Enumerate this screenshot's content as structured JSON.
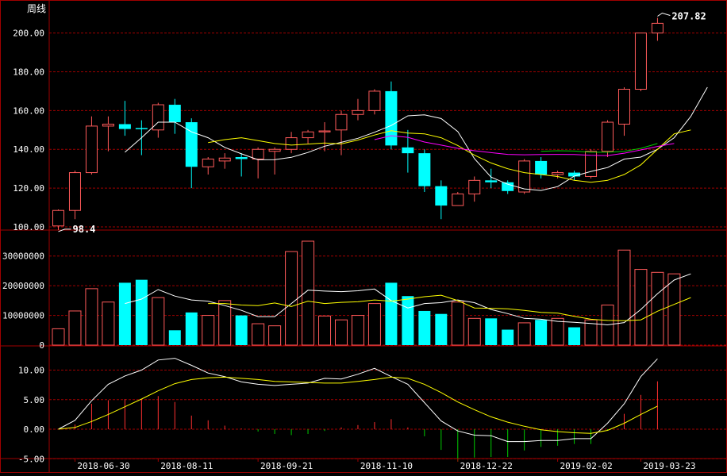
{
  "title": "周线",
  "colors": {
    "background": "#000000",
    "frame": "#a00000",
    "grid": "#a00000",
    "up": "#ff5a5a",
    "down": "#00ffff",
    "axis_text": "#ffffff",
    "ma_white": "#ffffff",
    "ma_yellow": "#ffff00",
    "ma_magenta": "#ff00ff",
    "ma_green": "#00cc00",
    "macd_pos": "#ff3030",
    "macd_neg": "#00cc00"
  },
  "x_labels": [
    "2018-06-30",
    "2018-08-11",
    "2018-09-21",
    "2018-11-10",
    "2018-12-22",
    "2019-02-02",
    "2019-03-23"
  ],
  "chart_data": [
    {
      "type": "candlestick",
      "panel": "price",
      "ylim": [
        100,
        207.82
      ],
      "yticks": [
        100,
        120,
        140,
        160,
        180,
        200
      ],
      "ytick_labels": [
        "100.00",
        "120.00",
        "140.00",
        "160.00",
        "180.00",
        "200.00"
      ],
      "annotations": {
        "max_label": "207.82",
        "min_label": "98.4"
      },
      "candles": [
        {
          "o": 100.5,
          "h": 109,
          "l": 98.4,
          "c": 108.5
        },
        {
          "o": 108.5,
          "h": 129,
          "l": 104,
          "c": 128
        },
        {
          "o": 128,
          "h": 157,
          "l": 127,
          "c": 152
        },
        {
          "o": 152,
          "h": 157,
          "l": 139,
          "c": 153
        },
        {
          "o": 153,
          "h": 165,
          "l": 147,
          "c": 150.5
        },
        {
          "o": 151,
          "h": 155,
          "l": 137,
          "c": 150.5
        },
        {
          "o": 150,
          "h": 164,
          "l": 146,
          "c": 163
        },
        {
          "o": 163,
          "h": 166,
          "l": 148,
          "c": 154
        },
        {
          "o": 154,
          "h": 156,
          "l": 120,
          "c": 131
        },
        {
          "o": 131,
          "h": 136,
          "l": 127,
          "c": 135
        },
        {
          "o": 134,
          "h": 138,
          "l": 130,
          "c": 135.5
        },
        {
          "o": 136,
          "h": 138,
          "l": 126,
          "c": 135
        },
        {
          "o": 135,
          "h": 141,
          "l": 125,
          "c": 140
        },
        {
          "o": 139,
          "h": 141,
          "l": 127,
          "c": 140
        },
        {
          "o": 140,
          "h": 149,
          "l": 138,
          "c": 146
        },
        {
          "o": 146,
          "h": 150,
          "l": 143,
          "c": 149
        },
        {
          "o": 149,
          "h": 154,
          "l": 139,
          "c": 149.5
        },
        {
          "o": 150,
          "h": 160,
          "l": 137,
          "c": 158
        },
        {
          "o": 158,
          "h": 166,
          "l": 155,
          "c": 160
        },
        {
          "o": 160,
          "h": 171,
          "l": 158,
          "c": 170
        },
        {
          "o": 170,
          "h": 175,
          "l": 140,
          "c": 142
        },
        {
          "o": 141,
          "h": 150,
          "l": 128,
          "c": 138
        },
        {
          "o": 138,
          "h": 140,
          "l": 118,
          "c": 121
        },
        {
          "o": 121,
          "h": 124,
          "l": 104,
          "c": 111
        },
        {
          "o": 111,
          "h": 118,
          "l": 111,
          "c": 117
        },
        {
          "o": 117,
          "h": 126,
          "l": 113,
          "c": 124
        },
        {
          "o": 124,
          "h": 130,
          "l": 120,
          "c": 123
        },
        {
          "o": 123,
          "h": 124,
          "l": 117,
          "c": 118.5
        },
        {
          "o": 118,
          "h": 135,
          "l": 117,
          "c": 134
        },
        {
          "o": 134,
          "h": 136,
          "l": 125,
          "c": 127
        },
        {
          "o": 127,
          "h": 129,
          "l": 125,
          "c": 128
        },
        {
          "o": 128,
          "h": 129,
          "l": 124,
          "c": 126
        },
        {
          "o": 126,
          "h": 140,
          "l": 125,
          "c": 139
        },
        {
          "o": 139,
          "h": 155,
          "l": 136,
          "c": 154
        },
        {
          "o": 153,
          "h": 172,
          "l": 147,
          "c": 171
        },
        {
          "o": 171,
          "h": 200,
          "l": 170,
          "c": 200
        },
        {
          "o": 200,
          "h": 207.82,
          "l": 196,
          "c": 205
        }
      ],
      "series": [
        {
          "kind": "ma",
          "color": "ma_white",
          "start": 4,
          "values": [
            138.5,
            146,
            154,
            154,
            149,
            146,
            141,
            137.7,
            134.6,
            134.7,
            135.9,
            138.4,
            141.6,
            143.6,
            145.7,
            148.8,
            152.3,
            157.3,
            157.8,
            155.9,
            149.2,
            135.2,
            125.7,
            122,
            119.6,
            118.8,
            120.8,
            126.2,
            128.6,
            130.6,
            135,
            136,
            140,
            146,
            157,
            172
          ]
        },
        {
          "kind": "ma",
          "color": "ma_yellow",
          "start": 9,
          "values": [
            143.5,
            145,
            146,
            144.5,
            143,
            142.2,
            142.7,
            143.3,
            142.8,
            144.8,
            147.4,
            149.6,
            148.4,
            148,
            146,
            142,
            137,
            133,
            130,
            128,
            127,
            126,
            124,
            123,
            124,
            127,
            132,
            140,
            148,
            150
          ]
        },
        {
          "kind": "ma",
          "color": "ma_magenta",
          "start": 19,
          "values": [
            145,
            147,
            146.2,
            143.8,
            142.2,
            140.5,
            139.3,
            138.3,
            137.4,
            137.2,
            137.3,
            137.4,
            137.3,
            136.9,
            136.8,
            138,
            139.7,
            141.5,
            143
          ]
        },
        {
          "kind": "ma",
          "color": "ma_green",
          "start": 29,
          "values": [
            139,
            139.3,
            139.1,
            138.5,
            138.5,
            139,
            140.5,
            143
          ]
        }
      ]
    },
    {
      "type": "bar",
      "panel": "volume",
      "ylim": [
        0,
        35000000
      ],
      "yticks": [
        0,
        10000000,
        20000000,
        30000000
      ],
      "ytick_labels": [
        "0",
        "10000000",
        "20000000",
        "30000000"
      ],
      "values": [
        5500000,
        11500000,
        19000000,
        14500000,
        21000000,
        22000000,
        16000000,
        5000000,
        11000000,
        10000000,
        15000000,
        10000000,
        7200000,
        6500000,
        31500000,
        35000000,
        9800000,
        8500000,
        10000000,
        14000000,
        21000000,
        16500000,
        11500000,
        10500000,
        14500000,
        9000000,
        9000000,
        5200000,
        7500000,
        8500000,
        9000000,
        6000000,
        8500000,
        13500000,
        32000000,
        25500000,
        24500000,
        24000000
      ],
      "series": [
        {
          "kind": "ma",
          "color": "ma_white",
          "start": 4,
          "values": [
            14000000,
            15500000,
            18700000,
            16500000,
            15200000,
            14800000,
            13300000,
            11700000,
            9600000,
            9600000,
            14000000,
            18500000,
            18200000,
            18000000,
            18300000,
            18900000,
            15000000,
            12500000,
            14000000,
            14300000,
            15200000,
            14300000,
            12000000,
            10600000,
            9000000,
            8700000,
            8000000,
            7700000,
            7300000,
            6800000,
            7600000,
            12000000,
            17300000,
            21900000,
            24000000
          ]
        },
        {
          "kind": "ma",
          "color": "ma_yellow",
          "start": 9,
          "values": [
            14000000,
            14000000,
            13500000,
            13300000,
            14200000,
            13000000,
            14800000,
            14000000,
            14400000,
            14600000,
            15200000,
            14800000,
            15500000,
            16300000,
            16800000,
            15000000,
            12500000,
            12400000,
            12200000,
            11700000,
            11000000,
            10800000,
            9700000,
            8700000,
            8300000,
            8200000,
            8500000,
            11400000,
            13700000,
            16000000
          ]
        }
      ]
    },
    {
      "type": "bar",
      "panel": "macd",
      "ylim": [
        -5,
        12
      ],
      "yticks": [
        -5,
        0,
        5,
        10
      ],
      "ytick_labels": [
        "-5.00",
        "0.00",
        "5.00",
        "10.00"
      ],
      "histogram": [
        0,
        0.8,
        4.3,
        4.9,
        5.1,
        5.1,
        5.6,
        4.6,
        2.3,
        1.5,
        0.6,
        0.1,
        -0.4,
        -0.8,
        -1.0,
        -0.8,
        -0.3,
        0.3,
        0.7,
        1.2,
        1.7,
        0.3,
        -1.2,
        -3.5,
        -5.5,
        -4.8,
        -4.7,
        -4.7,
        -3.6,
        -3.0,
        -2.8,
        -2.5,
        -2.5,
        -0.2,
        2.6,
        5.8,
        8.1
      ],
      "series": [
        {
          "kind": "dif",
          "color": "ma_white",
          "start": 0,
          "values": [
            0,
            1.5,
            4.8,
            7.6,
            9.0,
            10.0,
            11.7,
            12.0,
            10.8,
            9.5,
            8.9,
            8.0,
            7.6,
            7.4,
            7.6,
            7.8,
            8.6,
            8.5,
            9.3,
            10.3,
            8.9,
            7.6,
            4.5,
            1.4,
            -0.3,
            -1.0,
            -1.1,
            -2.1,
            -2.1,
            -1.9,
            -1.9,
            -1.6,
            -1.6,
            1.0,
            4.3,
            8.9,
            11.9
          ]
        },
        {
          "kind": "dea",
          "color": "ma_yellow",
          "start": 0,
          "values": [
            0,
            0.3,
            1.3,
            2.5,
            3.8,
            5.1,
            6.5,
            7.7,
            8.4,
            8.7,
            8.8,
            8.6,
            8.4,
            8.1,
            8.0,
            7.9,
            7.8,
            7.8,
            8.1,
            8.4,
            8.8,
            8.6,
            7.6,
            6.2,
            4.6,
            3.3,
            2.1,
            1.2,
            0.5,
            -0.1,
            -0.4,
            -0.6,
            -0.7,
            -0.2,
            1.0,
            2.5,
            3.9
          ]
        }
      ]
    }
  ]
}
